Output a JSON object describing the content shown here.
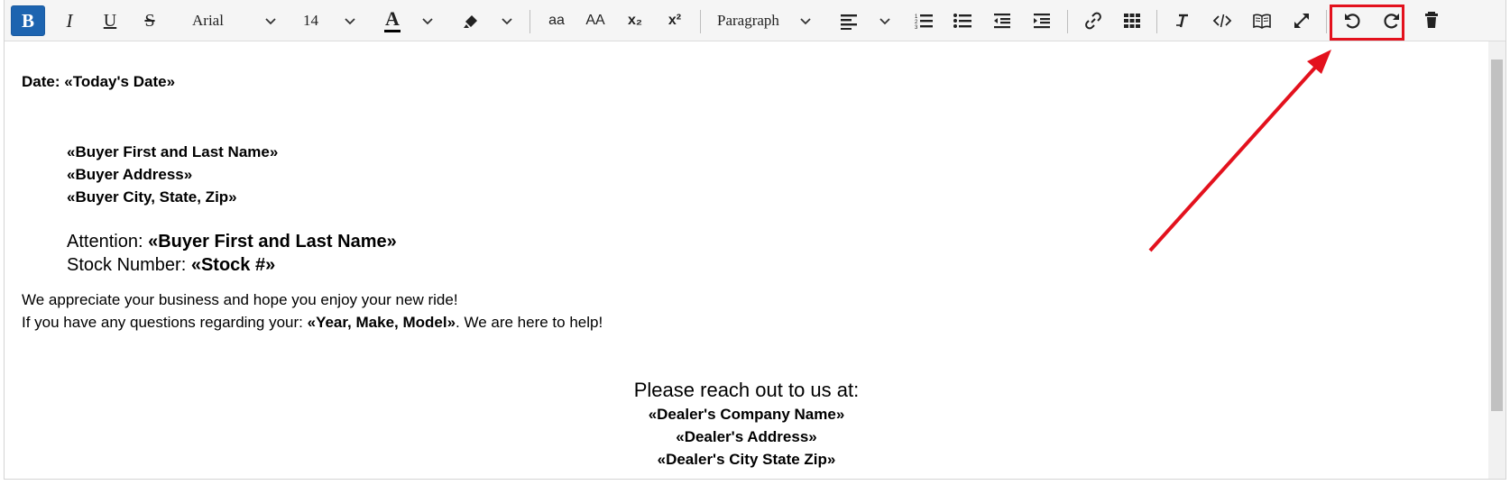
{
  "toolbar": {
    "bold_label": "B",
    "italic_label": "I",
    "underline_label": "U",
    "strike_label": "S",
    "font_family_value": "Arial",
    "font_size_value": "14",
    "text_color_label": "A",
    "lowercase_label": "aa",
    "uppercase_label": "AA",
    "subscript_label": "x₂",
    "superscript_label": "x²",
    "paragraph_value": "Paragraph",
    "icons": [
      "bold",
      "italic",
      "underline",
      "strikethrough",
      "chevron-down",
      "text-color-icon",
      "highlighter-icon",
      "align-left-icon",
      "ordered-list-icon",
      "unordered-list-icon",
      "outdent-icon",
      "indent-icon",
      "link-icon",
      "table-icon",
      "clear-format-icon",
      "code-view-icon",
      "book-icon",
      "fullscreen-icon",
      "undo-icon",
      "redo-icon",
      "trash-icon"
    ]
  },
  "document": {
    "date_label": "Date:",
    "date_field": "«Today's Date»",
    "buyer_name": "«Buyer First and Last Name»",
    "buyer_address": "«Buyer Address»",
    "buyer_city": "«Buyer City, State, Zip»",
    "attention_label": "Attention:",
    "attention_field": "«Buyer First and Last Name»",
    "stock_label": "Stock Number:",
    "stock_field": "«Stock #»",
    "appreciate_text": "We appreciate your business and hope you enjoy your new ride!",
    "questions_prefix": "If you have any questions regarding your:",
    "questions_field": "«Year, Make, Model»",
    "questions_suffix": ". We are here to help!",
    "reach_out": "Please reach out to us at:",
    "dealer_name": "«Dealer's Company Name»",
    "dealer_address": "«Dealer's Address»",
    "dealer_city": "«Dealer's City State Zip»"
  },
  "colors": {
    "accent": "#1d64b0",
    "annotation": "#e3111d"
  }
}
